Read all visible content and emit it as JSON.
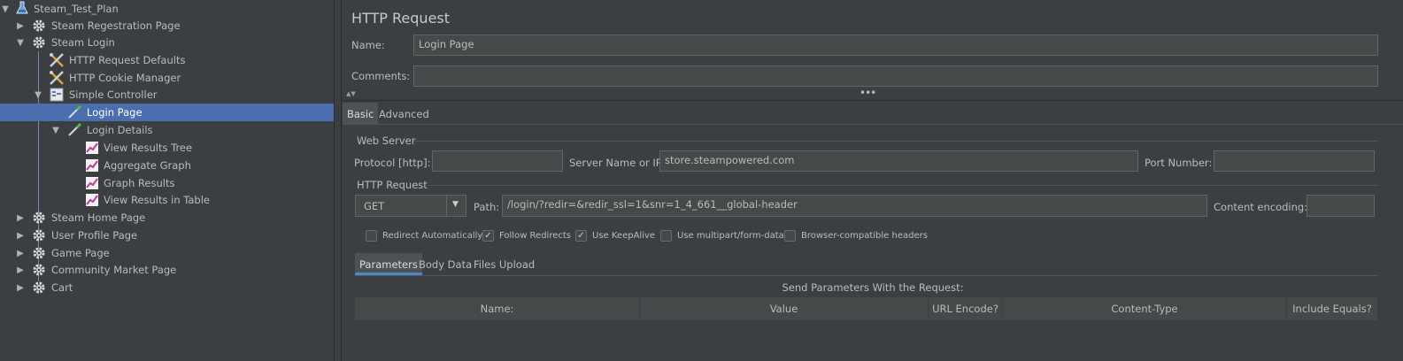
{
  "tree": {
    "items": [
      {
        "label": "Steam_Test_Plan",
        "icon": "flask-icon",
        "expanded": true
      },
      {
        "label": "Steam Regestration Page",
        "icon": "gear-icon",
        "expanded": false
      },
      {
        "label": "Steam Login",
        "icon": "gear-icon",
        "expanded": true
      },
      {
        "label": "HTTP Request Defaults",
        "icon": "tools-icon"
      },
      {
        "label": "HTTP Cookie Manager",
        "icon": "tools-icon"
      },
      {
        "label": "Simple Controller",
        "icon": "controller-icon",
        "expanded": true
      },
      {
        "label": "Login Page",
        "icon": "pipette-icon",
        "selected": true
      },
      {
        "label": "Login Details",
        "icon": "pipette-icon",
        "expanded": true
      },
      {
        "label": "View Results Tree",
        "icon": "graph-icon"
      },
      {
        "label": "Aggregate Graph",
        "icon": "graph-icon"
      },
      {
        "label": "Graph Results",
        "icon": "graph-icon"
      },
      {
        "label": "View Results in Table",
        "icon": "graph-icon"
      },
      {
        "label": "Steam Home Page",
        "icon": "gear-icon",
        "expanded": false
      },
      {
        "label": "User Profile Page",
        "icon": "gear-icon",
        "expanded": false
      },
      {
        "label": "Game Page",
        "icon": "gear-icon",
        "expanded": false
      },
      {
        "label": "Community Market Page",
        "icon": "gear-icon",
        "expanded": false
      },
      {
        "label": "Cart",
        "icon": "gear-icon",
        "expanded": false
      }
    ]
  },
  "panel": {
    "title": "HTTP Request",
    "name_label": "Name:",
    "name_value": "Login Page",
    "comments_label": "Comments:",
    "comments_value": "",
    "tabs": [
      "Basic",
      "Advanced"
    ],
    "web_server": {
      "section": "Web Server",
      "protocol_label": "Protocol [http]:",
      "protocol_value": "",
      "server_label": "Server Name or IP:",
      "server_value": "store.steampowered.com",
      "port_label": "Port Number:",
      "port_value": ""
    },
    "http_request": {
      "section": "HTTP Request",
      "method": "GET",
      "path_label": "Path:",
      "path_value": "/login/?redir=&redir_ssl=1&snr=1_4_661__global-header",
      "encoding_label": "Content encoding:",
      "encoding_value": ""
    },
    "checkboxes": [
      {
        "label": "Redirect Automatically",
        "checked": false
      },
      {
        "label": "Follow Redirects",
        "checked": true
      },
      {
        "label": "Use KeepAlive",
        "checked": true
      },
      {
        "label": "Use multipart/form-data",
        "checked": false
      },
      {
        "label": "Browser-compatible headers",
        "checked": false
      }
    ],
    "subtabs": [
      "Parameters",
      "Body Data",
      "Files Upload"
    ],
    "params_caption": "Send Parameters With the Request:",
    "columns": [
      "Name:",
      "Value",
      "URL Encode?",
      "Content-Type",
      "Include Equals?"
    ]
  },
  "colors": {
    "background": "#3c3f41",
    "selection": "#4b6eaf",
    "field": "#45494a"
  }
}
